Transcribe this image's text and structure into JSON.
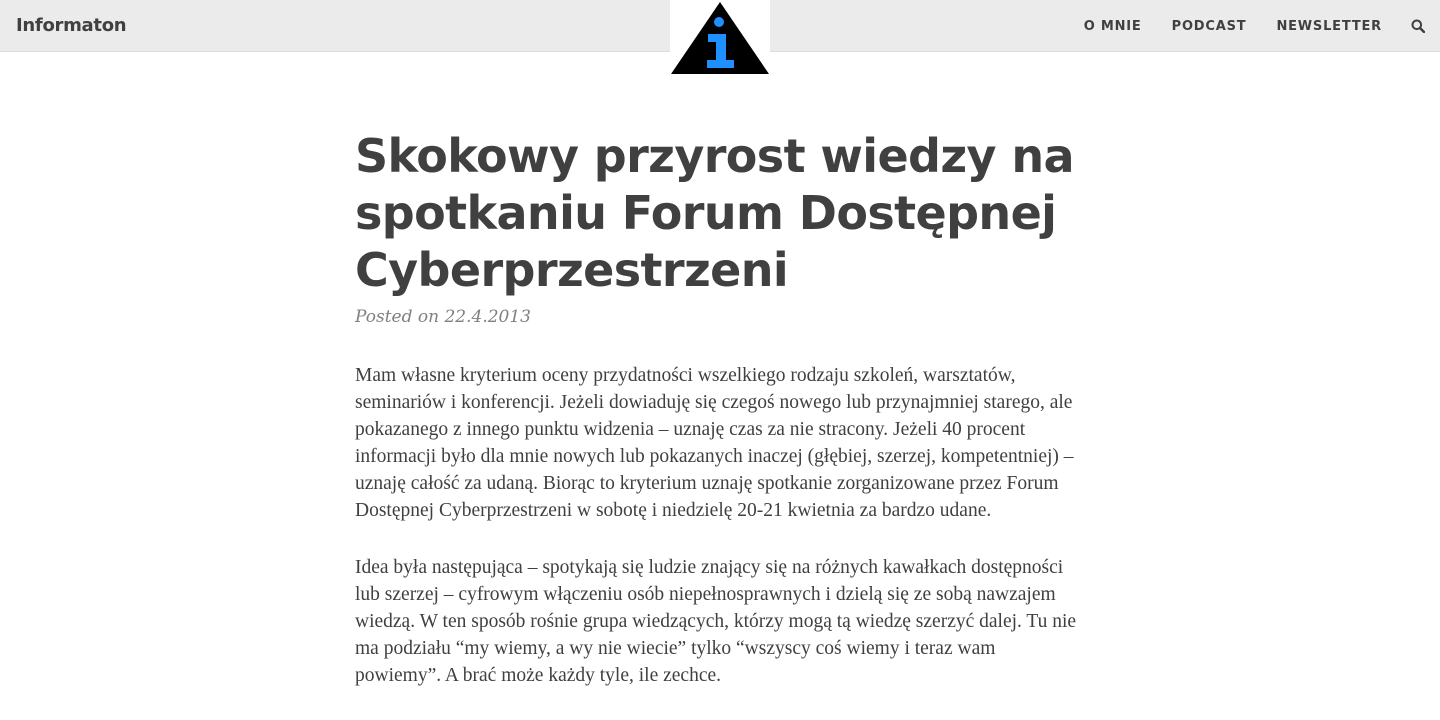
{
  "site": {
    "brand": "Informaton"
  },
  "nav": {
    "items": [
      {
        "label": "O MNIE"
      },
      {
        "label": "PODCAST"
      },
      {
        "label": "NEWSLETTER"
      }
    ],
    "search_icon": "search-icon"
  },
  "logo": {
    "icon": "information-sign-icon",
    "colors": {
      "triangle": "#000000",
      "glyph": "#1e90ff"
    }
  },
  "post": {
    "title": "Skokowy przyrost wiedzy na spotkaniu Forum Dostępnej Cyberprzestrzeni",
    "meta": "Posted on 22.4.2013",
    "paragraphs": [
      "Mam własne kryterium oceny przydatności wszelkiego rodzaju szkoleń, warsztatów, seminariów i konferencji. Jeżeli dowiaduję się czegoś nowego lub przynajmniej starego, ale pokazanego z innego punktu widzenia – uznaję czas za nie stracony. Jeżeli 40 procent informacji było dla mnie nowych lub pokazanych inaczej (głębiej, szerzej, kompetentniej) – uznaję całość za udaną. Biorąc to kryterium uznaję spotkanie zorganizowane przez Forum Dostępnej Cyberprzestrzeni w sobotę i niedzielę 20-21 kwietnia za bardzo udane.",
      "Idea była następująca – spotykają się ludzie znający się na różnych kawałkach dostępności lub szerzej – cyfrowym włączeniu osób niepełnosprawnych i dzielą się ze sobą nawzajem wiedzą. W ten sposób rośnie grupa wiedzących, którzy mogą tą wiedzę szerzyć dalej. Tu nie ma podziału “my wiemy, a wy nie wiecie” tylko “wszyscy coś wiemy i teraz wam powiemy”. A brać może każdy tyle, ile zechce."
    ]
  },
  "colors": {
    "navbar_bg": "#ebebeb",
    "text": "#404040",
    "meta_text": "#808080",
    "page_bg": "#ffffff"
  }
}
